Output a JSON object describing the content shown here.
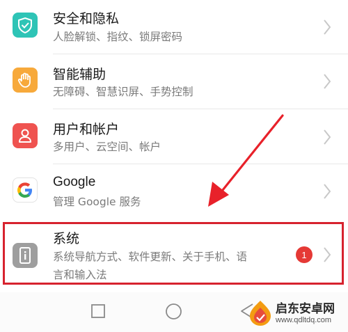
{
  "settings_items": [
    {
      "title": "安全和隐私",
      "subtitle": "人脸解锁、指纹、锁屏密码",
      "icon": "shield-check-icon",
      "color": "#2ec4b6"
    },
    {
      "title": "智能辅助",
      "subtitle": "无障碍、智慧识屏、手势控制",
      "icon": "hand-icon",
      "color": "#f7a93b"
    },
    {
      "title": "用户和帐户",
      "subtitle": "多用户、云空间、帐户",
      "icon": "user-icon",
      "color": "#ef5350"
    },
    {
      "title": "Google",
      "subtitle": "管理 Google 服务",
      "icon": "google-icon",
      "color": "#ffffff"
    },
    {
      "title": "系统",
      "subtitle_line1": "系统导航方式、软件更新、关于手机、语",
      "subtitle_line2": "言和输入法",
      "icon": "info-phone-icon",
      "color": "#9e9e9e",
      "badge": "1"
    }
  ],
  "nav": {
    "buttons": [
      "recent-apps-button",
      "home-button",
      "back-button"
    ]
  },
  "watermark": {
    "name": "启东安卓网",
    "url": "www.qdltdq.com"
  },
  "colors": {
    "highlight": "#d7222e",
    "arrow": "#e8212a",
    "badge": "#e53935"
  }
}
